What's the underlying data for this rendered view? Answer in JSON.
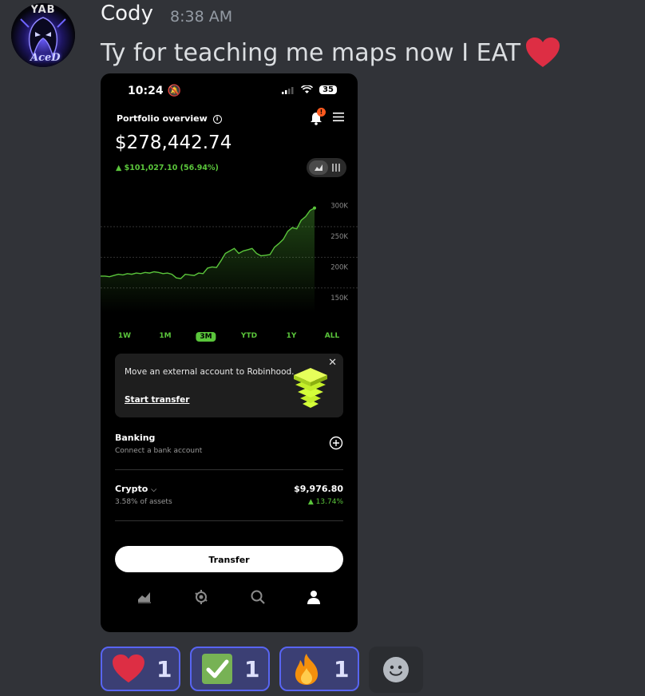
{
  "message": {
    "author": "Cody",
    "time": "8:38 AM",
    "text": "Ty for teaching me maps now I EAT",
    "avatar_text_top": "YAB",
    "avatar_text_bottom": "AceD",
    "emoji": "heart-emoji"
  },
  "phone": {
    "status_time": "10:24",
    "battery": "35",
    "portfolio_label": "Portfolio overview",
    "notification_badge": "!",
    "balance": "$278,442.74",
    "gain": "▲ $101,027.10 (56.94%)",
    "chart_data": {
      "type": "line",
      "y_ticks": [
        "300K",
        "250K",
        "200K",
        "150K"
      ],
      "ylim": [
        125000,
        315000
      ],
      "values": [
        185000,
        185000,
        184000,
        186000,
        188000,
        187000,
        189000,
        188000,
        190000,
        189000,
        191000,
        190000,
        192000,
        191000,
        189000,
        190000,
        188000,
        182000,
        181000,
        188000,
        187000,
        186000,
        190000,
        189000,
        198000,
        200000,
        199000,
        210000,
        222000,
        226000,
        230000,
        222000,
        226000,
        228000,
        230000,
        222000,
        218000,
        219000,
        220000,
        232000,
        238000,
        245000,
        258000,
        264000,
        262000,
        276000,
        282000,
        292000,
        296000
      ],
      "line_color": "#5ac53b"
    },
    "ranges": [
      "1W",
      "1M",
      "3M",
      "YTD",
      "1Y",
      "ALL"
    ],
    "active_range": "3M",
    "card": {
      "text": "Move an external account to Robinhood.",
      "link": "Start transfer",
      "close": "✕"
    },
    "banking": {
      "title": "Banking",
      "subtitle": "Connect a bank account"
    },
    "crypto": {
      "title": "Crypto",
      "subtitle": "3.58% of assets",
      "value": "$9,976.80",
      "change": "▲ 13.74%"
    },
    "transfer_button": "Transfer",
    "tabs": [
      "chart-tab-icon",
      "crypto-tab-icon",
      "search-tab-icon",
      "account-tab-icon"
    ]
  },
  "reactions": [
    {
      "emoji": "heart-emoji",
      "count": "1"
    },
    {
      "emoji": "check-mark-emoji",
      "count": "1"
    },
    {
      "emoji": "fire-emoji",
      "count": "1"
    }
  ]
}
